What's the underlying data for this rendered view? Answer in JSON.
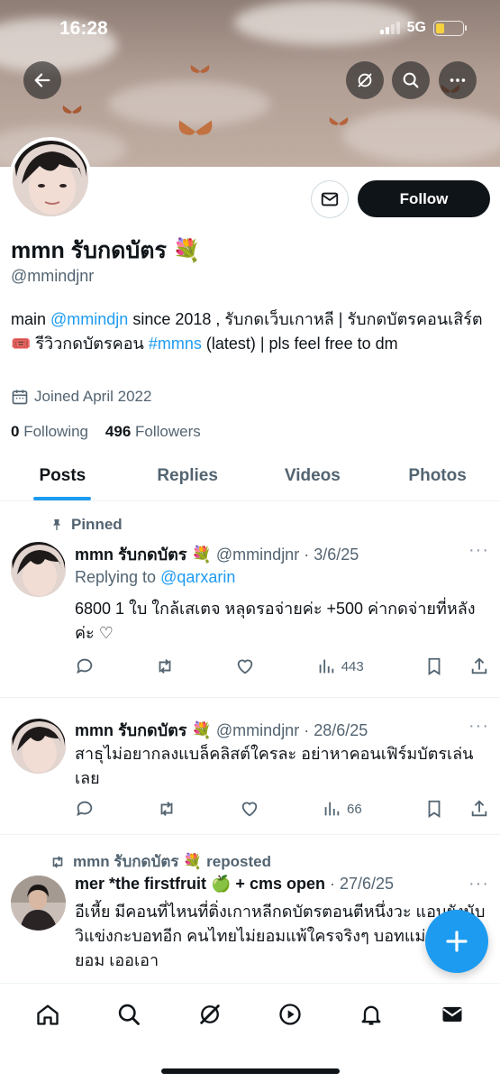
{
  "status": {
    "time": "16:28",
    "network": "5G"
  },
  "profile": {
    "name": "mmn รับกดบัตร 💐",
    "handle": "@mmindjnr",
    "bio_parts": [
      {
        "text": "main ",
        "link": false
      },
      {
        "text": "@mmindjn",
        "link": true
      },
      {
        "text": " since 2018 , รับกดเว็บเกาหลี | รับกดบัตรคอนเสิร์ต 🎟️          รีวิวกดบัตรคอน ",
        "link": false
      },
      {
        "text": "#mmns",
        "link": true
      },
      {
        "text": " (latest) | pls feel free to dm",
        "link": false
      }
    ],
    "joined": "Joined April 2022",
    "following_count": "0",
    "following_label": "Following",
    "followers_count": "496",
    "followers_label": "Followers",
    "follow_label": "Follow"
  },
  "tabs": [
    {
      "label": "Posts"
    },
    {
      "label": "Replies"
    },
    {
      "label": "Videos"
    },
    {
      "label": "Photos"
    }
  ],
  "posts": [
    {
      "context": "Pinned",
      "name": "mmn รับกดบัตร 💐",
      "handle": "@mmindjnr",
      "date": "· 3/6/25",
      "reply_prefix": "Replying to",
      "reply_to": "@qarxarin",
      "text": "6800 1 ใบ ใกล้เสเตจ หลุดรอจ่ายค่ะ +500 ค่ากดจ่ายที่หลังค่ะ ♡",
      "views": "443"
    },
    {
      "name": "mmn รับกดบัตร 💐",
      "handle": "@mmindjnr",
      "date": "· 28/6/25",
      "text": "สาธุไม่อยากลงแบล็คลิสต์ใครละ อย่าหาคอนเฟิร์มบัตรเล่นเลย",
      "views": "66"
    },
    {
      "context": "mmn รับกดบัตร 💐 reposted",
      "name": "mer *the firstfruit 🍏 + cms open",
      "date": "· 27/6/25",
      "text": "อีเหี้ย มีคอนที่ไหนที่ติ่งเกาหลีกดบัตรตอนตีหนึ่งวะ แอบยังนับวิแข่งกะบอทอีก คนไทยไม่ยอมแพ้ใครจริงๆ บอทแม่งยังไม่ยอม เออเอา"
    }
  ],
  "icons": {
    "back": "back-arrow-icon",
    "grok": "grok-icon",
    "search": "search-icon",
    "more": "more-icon"
  },
  "colors": {
    "accent": "#1d9bf0",
    "text": "#0f1419",
    "muted": "#536471"
  }
}
